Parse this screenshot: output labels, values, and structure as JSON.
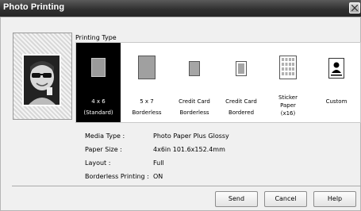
{
  "window": {
    "title": "Photo Printing"
  },
  "printing_type": {
    "label": "Printing Type",
    "items": [
      {
        "line1": "4 x 6",
        "line2": "(Standard)",
        "selected": true
      },
      {
        "line1": "5 x 7",
        "line2": "Borderless",
        "selected": false
      },
      {
        "line1": "Credit Card",
        "line2": "Borderless",
        "selected": false
      },
      {
        "line1": "Credit Card",
        "line2": "Bordered",
        "selected": false
      },
      {
        "line1": "Sticker",
        "line2": "Paper",
        "line3": "(x16)",
        "selected": false
      },
      {
        "line1": "Custom",
        "selected": false
      }
    ]
  },
  "details": {
    "media_type_label": "Media Type :",
    "media_type_value": "Photo Paper Plus Glossy",
    "paper_size_label": "Paper Size :",
    "paper_size_value": "4x6in 101.6x152.4mm",
    "layout_label": "Layout :",
    "layout_value": "Full",
    "borderless_label": "Borderless Printing :",
    "borderless_value": "ON"
  },
  "buttons": {
    "send": "Send",
    "cancel": "Cancel",
    "help": "Help"
  }
}
